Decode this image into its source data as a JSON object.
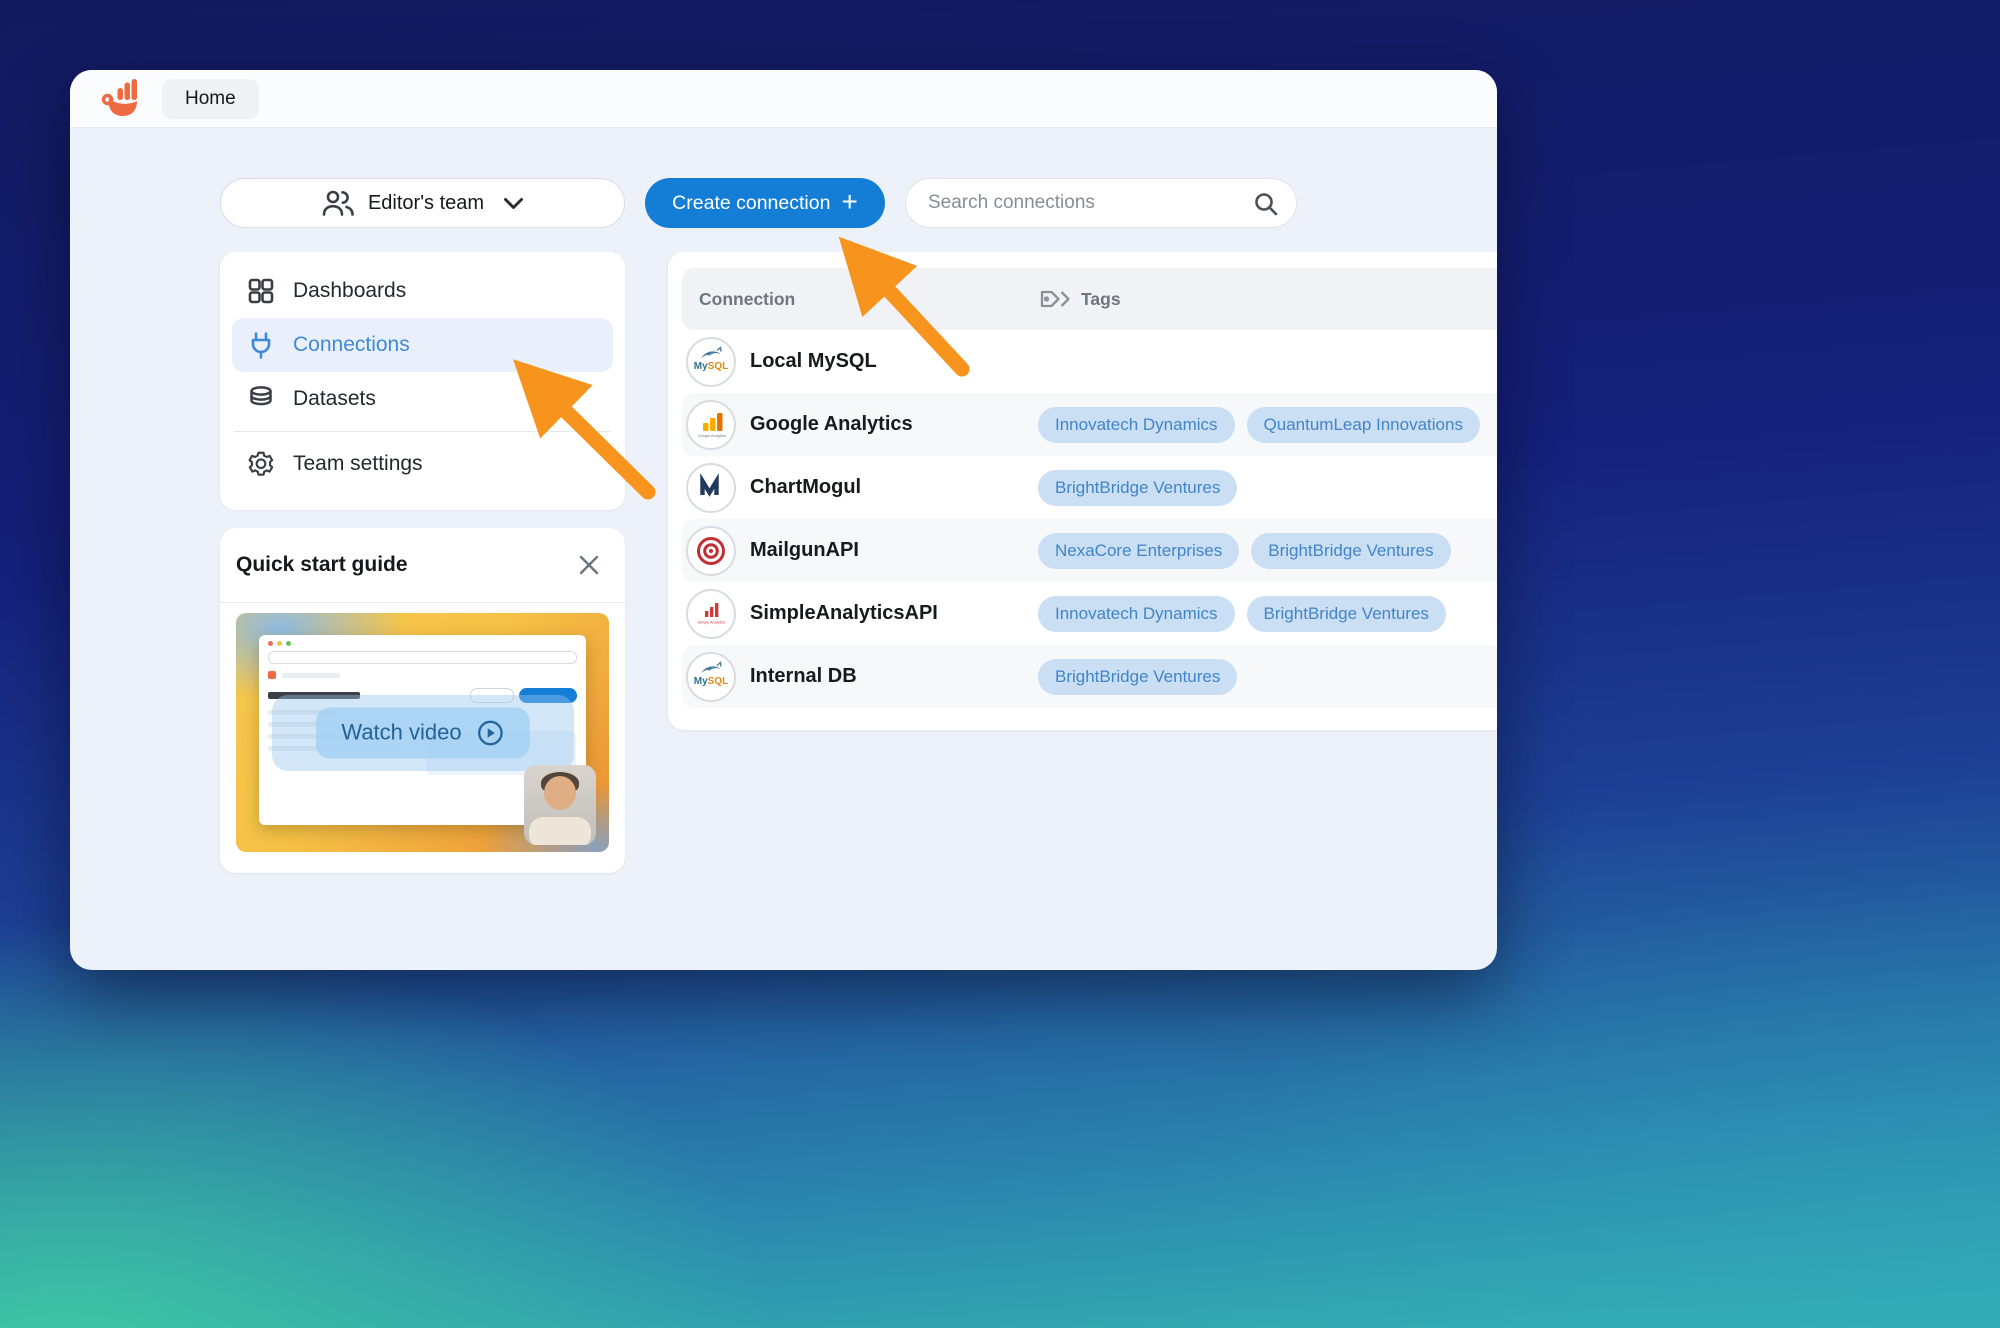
{
  "app": {
    "home_tab": "Home",
    "logo_icon": "brand-hand-chart-icon"
  },
  "toolbar": {
    "team_selector_label": "Editor's team",
    "create_connection_label": "Create connection",
    "create_connection_plus": "+",
    "search_placeholder": "Search connections"
  },
  "sidebar": {
    "items": [
      {
        "id": "dashboards",
        "label": "Dashboards",
        "icon": "grid-icon",
        "active": false
      },
      {
        "id": "connections",
        "label": "Connections",
        "icon": "plug-icon",
        "active": true
      },
      {
        "id": "datasets",
        "label": "Datasets",
        "icon": "database-icon",
        "active": false
      },
      {
        "id": "team-settings",
        "label": "Team settings",
        "icon": "gear-icon",
        "active": false,
        "divider_before": true
      }
    ]
  },
  "quick_start": {
    "title": "Quick start guide",
    "watch_video_label": "Watch video",
    "close_icon": "close-icon",
    "play_icon": "play-circle-icon"
  },
  "connections_table": {
    "columns": [
      {
        "key": "connection",
        "label": "Connection"
      },
      {
        "key": "tags",
        "label": "Tags",
        "icon": "tags-icon"
      }
    ],
    "rows": [
      {
        "name": "Local MySQL",
        "icon": "mysql-logo-icon",
        "tags": []
      },
      {
        "name": "Google Analytics",
        "icon": "google-analytics-logo-icon",
        "tags": [
          "Innovatech Dynamics",
          "QuantumLeap Innovations"
        ]
      },
      {
        "name": "ChartMogul",
        "icon": "chartmogul-logo-icon",
        "tags": [
          "BrightBridge Ventures"
        ]
      },
      {
        "name": "MailgunAPI",
        "icon": "mailgun-logo-icon",
        "tags": [
          "NexaCore Enterprises",
          "BrightBridge Ventures"
        ]
      },
      {
        "name": "SimpleAnalyticsAPI",
        "icon": "simple-analytics-logo-icon",
        "tags": [
          "Innovatech Dynamics",
          "BrightBridge Ventures"
        ]
      },
      {
        "name": "Internal DB",
        "icon": "mysql-logo-icon",
        "tags": [
          "BrightBridge Ventures"
        ]
      }
    ]
  },
  "annotations": {
    "arrows": [
      {
        "target": "create-connection-button"
      },
      {
        "target": "sidebar-item-connections"
      }
    ]
  },
  "colors": {
    "accent_blue": "#147ED6",
    "active_item_blue": "#4089D6",
    "tag_bg": "#CADEF4",
    "tag_text": "#4285C8",
    "arrow_orange": "#F7941E",
    "logo_orange": "#EE6A41",
    "window_bg": "#EDF1F9",
    "bg_gradient_top": "#121A5E",
    "bg_gradient_bottom": "#38C2AB"
  }
}
